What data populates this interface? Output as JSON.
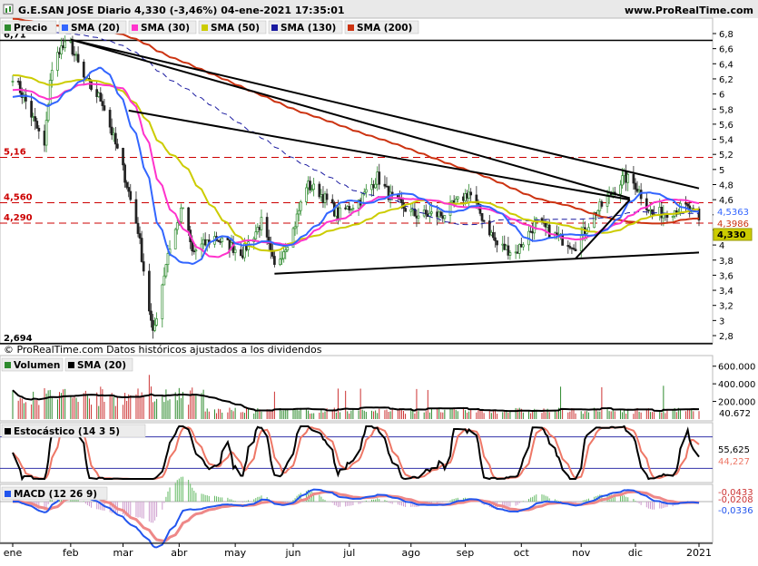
{
  "header": {
    "title": "G.E.SAN JOSE Diario 4,330 (-3,46%) 04-ene-2021 17:35:01",
    "site": "www.ProRealTime.com"
  },
  "colors": {
    "price_up": "#2e8b2e",
    "price_down": "#222222",
    "sma20": "#3366ff",
    "sma30": "#ff33cc",
    "sma50": "#cccc00",
    "sma130": "#1a1aa0",
    "sma200": "#cc3311",
    "volume_sma": "#000000",
    "stoch_k": "#000000",
    "stoch_d": "#ee7766",
    "macd": "#2255ee",
    "macd_signal": "#ee8888",
    "histogram": "#cc99cc",
    "ref_line": "#cc0000",
    "trendline": "#000000"
  },
  "chart_data": [
    {
      "type": "candlestick",
      "panel": "price",
      "legend": [
        {
          "label": "Precio",
          "color": "#2e8b2e"
        },
        {
          "label": "SMA (20)",
          "color": "#3366ff"
        },
        {
          "label": "SMA (30)",
          "color": "#ff33cc"
        },
        {
          "label": "SMA (50)",
          "color": "#cccc00"
        },
        {
          "label": "SMA (130)",
          "color": "#1a1aa0"
        },
        {
          "label": "SMA (200)",
          "color": "#cc3311"
        }
      ],
      "y_ticks": [
        "6,8",
        "6,6",
        "6,4",
        "6,2",
        "6",
        "5,8",
        "5,6",
        "5,4",
        "5,2",
        "5",
        "4,8",
        "4,6",
        "4,4",
        "4,2",
        "4",
        "3,8",
        "3,6",
        "3,4",
        "3,2",
        "3",
        "2,8"
      ],
      "ylim": [
        2.7,
        6.9
      ],
      "ref_levels": [
        {
          "value": 6.71,
          "label": "6,71",
          "style": "solid"
        },
        {
          "value": 5.16,
          "label": "5,16",
          "style": "dashed"
        },
        {
          "value": 4.56,
          "label": "4,560",
          "style": "dashed"
        },
        {
          "value": 4.29,
          "label": "4,290",
          "style": "dashed"
        },
        {
          "value": 2.694,
          "label": "2,694",
          "style": "solid"
        }
      ],
      "last_values": [
        {
          "label": "4,5363",
          "value": 4.5363,
          "color": "#3366ff"
        },
        {
          "label": "4,3986",
          "value": 4.3986,
          "color": "#cc3311"
        },
        {
          "label": "4,330",
          "value": 4.33,
          "color": "#cccc00"
        }
      ],
      "price_anchors": [
        [
          "2020-01-02",
          6.3
        ],
        [
          "2020-01-10",
          5.9
        ],
        [
          "2020-01-20",
          5.3
        ],
        [
          "2020-01-23",
          6.2
        ],
        [
          "2020-01-28",
          6.6
        ],
        [
          "2020-02-03",
          6.65
        ],
        [
          "2020-02-10",
          6.2
        ],
        [
          "2020-02-20",
          5.9
        ],
        [
          "2020-03-02",
          5.0
        ],
        [
          "2020-03-10",
          4.2
        ],
        [
          "2020-03-18",
          2.8
        ],
        [
          "2020-03-26",
          3.9
        ],
        [
          "2020-04-03",
          4.5
        ],
        [
          "2020-04-08",
          3.9
        ],
        [
          "2020-04-20",
          4.1
        ],
        [
          "2020-05-05",
          3.9
        ],
        [
          "2020-05-15",
          4.3
        ],
        [
          "2020-05-22",
          3.7
        ],
        [
          "2020-06-01",
          4.2
        ],
        [
          "2020-06-08",
          4.8
        ],
        [
          "2020-06-15",
          4.7
        ],
        [
          "2020-06-25",
          4.4
        ],
        [
          "2020-07-07",
          4.6
        ],
        [
          "2020-07-16",
          4.9
        ],
        [
          "2020-07-24",
          4.6
        ],
        [
          "2020-08-05",
          4.4
        ],
        [
          "2020-08-20",
          4.4
        ],
        [
          "2020-09-03",
          4.7
        ],
        [
          "2020-09-18",
          4.0
        ],
        [
          "2020-09-28",
          3.9
        ],
        [
          "2020-10-09",
          4.3
        ],
        [
          "2020-10-20",
          4.1
        ],
        [
          "2020-10-30",
          4.0
        ],
        [
          "2020-11-09",
          4.4
        ],
        [
          "2020-11-25",
          4.9
        ],
        [
          "2020-12-01",
          4.8
        ],
        [
          "2020-12-10",
          4.4
        ],
        [
          "2020-12-28",
          4.5
        ],
        [
          "2021-01-04",
          4.33
        ]
      ],
      "trendlines": [
        {
          "from": [
            "2020-02-03",
            6.72
          ],
          "to": [
            "2021-01-04",
            4.75
          ]
        },
        {
          "from": [
            "2020-02-03",
            6.72
          ],
          "to": [
            "2020-11-28",
            4.62
          ]
        },
        {
          "from": [
            "2020-03-05",
            5.78
          ],
          "to": [
            "2020-11-28",
            4.6
          ]
        },
        {
          "from": [
            "2020-05-22",
            3.62
          ],
          "to": [
            "2021-01-04",
            3.9
          ]
        },
        {
          "from": [
            "2020-10-30",
            3.82
          ],
          "to": [
            "2020-11-28",
            4.6
          ]
        }
      ]
    },
    {
      "type": "bar",
      "panel": "volume",
      "legend": [
        {
          "label": "Volumen",
          "color": "#2e8b2e"
        },
        {
          "label": "SMA (20)",
          "color": "#000000"
        }
      ],
      "y_ticks": [
        "600.000",
        "400.000",
        "200.000"
      ],
      "ylim": [
        0,
        700000
      ],
      "last_value": "40.672"
    },
    {
      "type": "line",
      "panel": "stochastic",
      "legend": [
        {
          "label": "Estocástico (14 3 5)",
          "color": "#000000"
        }
      ],
      "bands": [
        80,
        20
      ],
      "ylim": [
        0,
        100
      ],
      "last_values": [
        "55,625",
        "44,227"
      ]
    },
    {
      "type": "line",
      "panel": "macd",
      "legend": [
        {
          "label": "MACD (12 26 9)",
          "color": "#2255ee"
        }
      ],
      "last_values": [
        "-0,0433",
        "-0,0208",
        "-0,0336"
      ]
    }
  ],
  "x_axis": {
    "months": [
      {
        "label": "ene",
        "date": "2020-01-03"
      },
      {
        "label": "feb",
        "date": "2020-02-03"
      },
      {
        "label": "mar",
        "date": "2020-03-02"
      },
      {
        "label": "abr",
        "date": "2020-04-01"
      },
      {
        "label": "may",
        "date": "2020-05-01"
      },
      {
        "label": "jun",
        "date": "2020-06-01"
      },
      {
        "label": "jul",
        "date": "2020-07-01"
      },
      {
        "label": "ago",
        "date": "2020-08-03"
      },
      {
        "label": "sep",
        "date": "2020-09-01"
      },
      {
        "label": "oct",
        "date": "2020-10-01"
      },
      {
        "label": "nov",
        "date": "2020-11-02"
      },
      {
        "label": "dic",
        "date": "2020-12-01"
      },
      {
        "label": "2021",
        "date": "2021-01-04"
      }
    ]
  },
  "footer_note": "© ProRealTime.com  Datos históricos ajustados a los dividendos"
}
